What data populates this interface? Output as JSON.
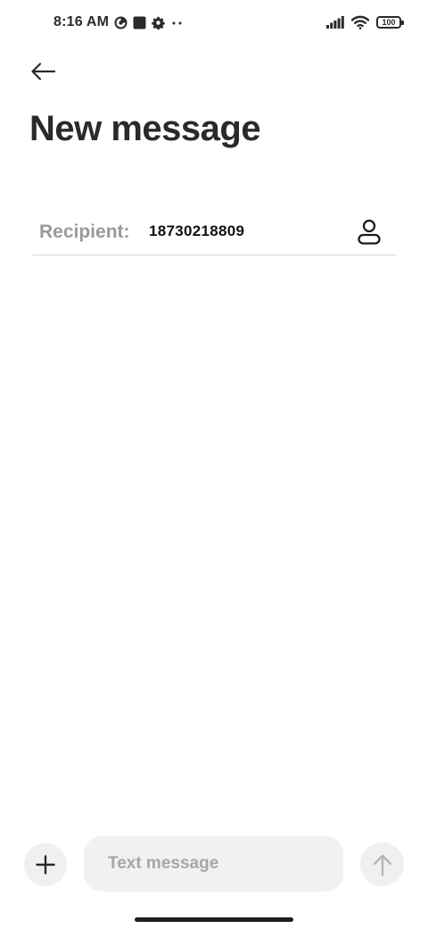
{
  "status_bar": {
    "time": "8:16 AM",
    "battery_level": "100",
    "icons": [
      "data-saver-icon",
      "square-notification-icon",
      "settings-gear-icon",
      "more-dots-icon",
      "signal-bars-icon",
      "wifi-icon",
      "battery-icon"
    ]
  },
  "header": {
    "back_icon": "arrow-left-icon",
    "title": "New message"
  },
  "recipient": {
    "label": "Recipient:",
    "value": "18730218809",
    "contact_icon": "person-icon"
  },
  "composer": {
    "attach_icon": "plus-icon",
    "placeholder": "Text message",
    "send_icon": "arrow-up-icon"
  },
  "colors": {
    "title": "#2a2a2a",
    "label_gray": "#9a9a9a",
    "input_bg": "#f1f1f1",
    "divider": "#d6d6d6"
  }
}
